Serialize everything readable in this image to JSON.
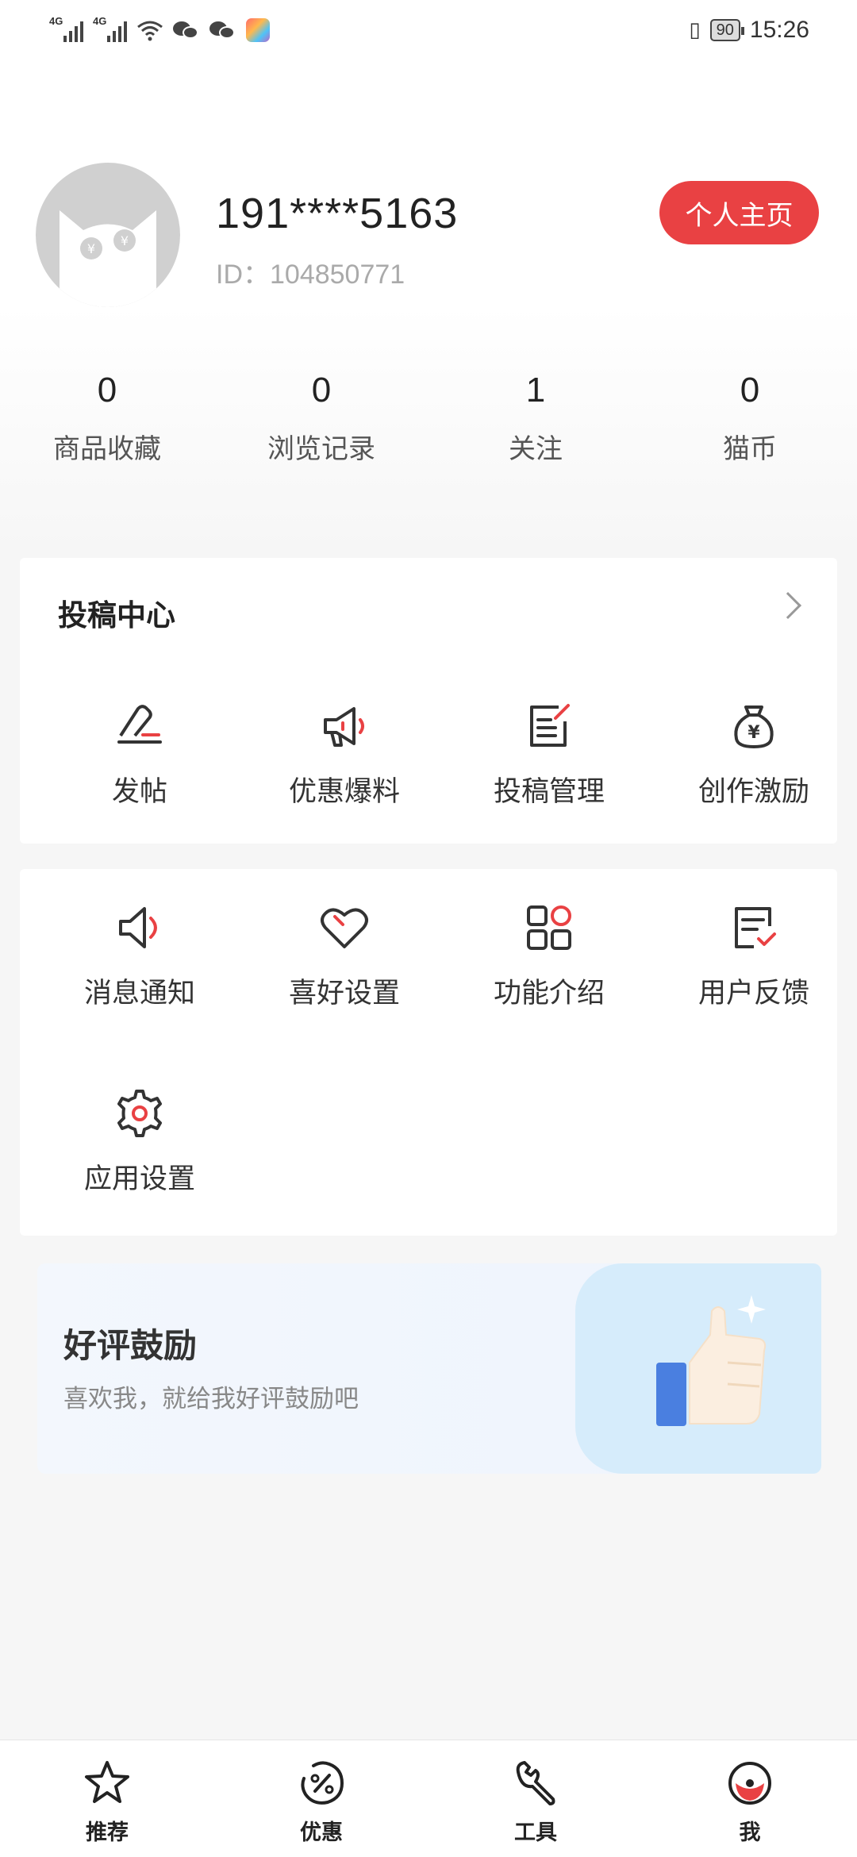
{
  "status_bar": {
    "signal_labels": [
      "4G",
      "4G"
    ],
    "icons": [
      "signal-icon",
      "signal-icon",
      "wifi-icon",
      "wechat-icon",
      "wechat-icon",
      "app-icon",
      "vibrate-icon",
      "battery-icon"
    ],
    "battery": "90",
    "time": "15:26"
  },
  "profile": {
    "username": "191****5163",
    "user_id": "ID：104850771",
    "home_button": "个人主页",
    "avatar_icon": "cat-avatar-icon"
  },
  "stats": [
    {
      "value": "0",
      "label": "商品收藏"
    },
    {
      "value": "0",
      "label": "浏览记录"
    },
    {
      "value": "1",
      "label": "关注"
    },
    {
      "value": "0",
      "label": "猫币"
    }
  ],
  "submission_center": {
    "title": "投稿中心",
    "items": [
      {
        "label": "发帖",
        "icon": "post-pen-icon"
      },
      {
        "label": "优惠爆料",
        "icon": "megaphone-icon"
      },
      {
        "label": "投稿管理",
        "icon": "manage-doc-icon"
      },
      {
        "label": "创作激励",
        "icon": "money-bag-icon"
      }
    ]
  },
  "settings_grid": {
    "items": [
      {
        "label": "消息通知",
        "icon": "speaker-icon"
      },
      {
        "label": "喜好设置",
        "icon": "heart-icon"
      },
      {
        "label": "功能介绍",
        "icon": "apps-grid-icon"
      },
      {
        "label": "用户反馈",
        "icon": "feedback-icon"
      },
      {
        "label": "应用设置",
        "icon": "gear-icon"
      }
    ]
  },
  "rating_banner": {
    "title": "好评鼓励",
    "subtitle": "喜欢我，就给我好评鼓励吧",
    "icon": "thumbs-up-icon"
  },
  "tabbar": {
    "items": [
      {
        "label": "推荐",
        "icon": "star-icon"
      },
      {
        "label": "优惠",
        "icon": "discount-icon"
      },
      {
        "label": "工具",
        "icon": "wrench-icon"
      },
      {
        "label": "我",
        "icon": "me-icon"
      }
    ],
    "active_color": "#e94143"
  },
  "colors": {
    "accent": "#e94143",
    "background": "#f6f6f6"
  }
}
